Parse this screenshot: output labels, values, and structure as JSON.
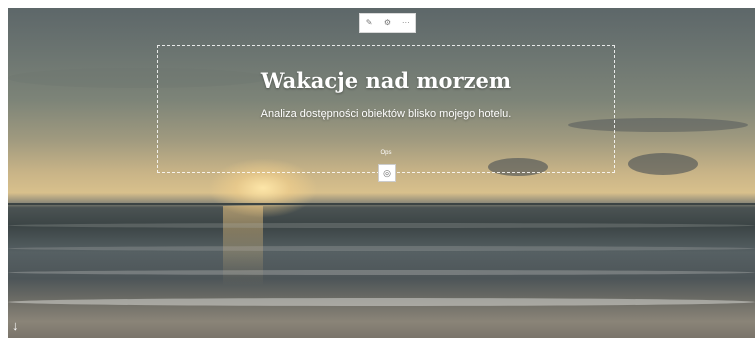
{
  "hero": {
    "title": "Wakacje nad morzem",
    "subtitle": "Analiza dostępności obiektów blisko mojego hotelu."
  },
  "mini_toolbar": {
    "edit_icon": "pencil-icon",
    "settings_icon": "gear-icon",
    "more_icon": "ellipsis-icon",
    "edit_glyph": "✎",
    "settings_glyph": "⚙",
    "more_glyph": "···"
  },
  "ops": {
    "label": "Ops",
    "button_icon": "eye-slash-icon",
    "button_glyph": "◎"
  },
  "scroll": {
    "icon": "arrow-down-icon",
    "glyph": "↓"
  }
}
